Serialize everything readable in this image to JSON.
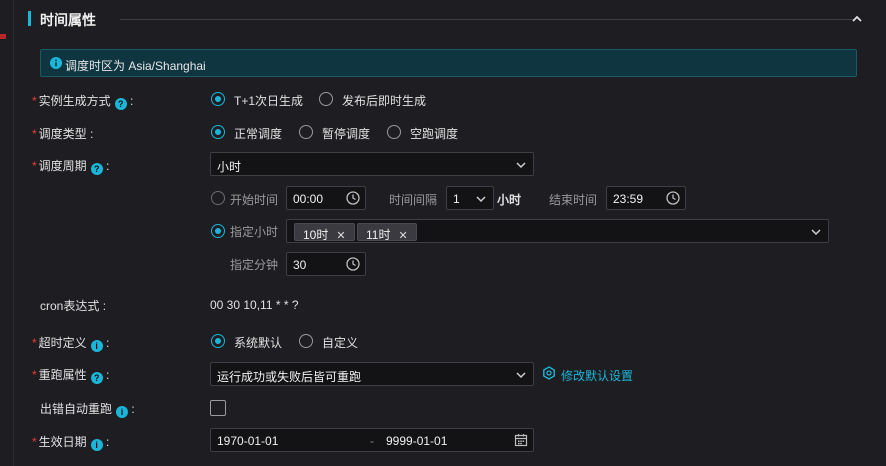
{
  "section": {
    "title": "时间属性"
  },
  "info": {
    "text": "调度时区为 Asia/Shanghai"
  },
  "instance_mode": {
    "label": "实例生成方式",
    "options": [
      "T+1次日生成",
      "发布后即时生成"
    ],
    "selected": 0
  },
  "schedule_type": {
    "label": "调度类型",
    "options": [
      "正常调度",
      "暂停调度",
      "空跑调度"
    ],
    "selected": 0
  },
  "schedule_cycle": {
    "label": "调度周期",
    "value": "小时",
    "mode_range": {
      "label": "开始时间",
      "start_time": "00:00",
      "interval_label": "时间间隔",
      "interval_value": "1",
      "interval_unit": "小时",
      "end_label": "结束时间",
      "end_time": "23:59"
    },
    "mode_specific": {
      "label": "指定小时",
      "tags": [
        "10时",
        "11时"
      ]
    },
    "minute": {
      "label": "指定分钟",
      "value": "30"
    },
    "selected_mode": "specific"
  },
  "cron": {
    "label": "cron表达式",
    "value": "00 30 10,11 * * ?"
  },
  "timeout": {
    "label": "超时定义",
    "options": [
      "系统默认",
      "自定义"
    ],
    "selected": 0
  },
  "rerun": {
    "label": "重跑属性",
    "value": "运行成功或失败后皆可重跑",
    "link": "修改默认设置"
  },
  "auto_rerun": {
    "label": "出错自动重跑",
    "checked": false
  },
  "effective_date": {
    "label": "生效日期",
    "start": "1970-01-01",
    "separator": "-",
    "end": "9999-01-01"
  },
  "colors": {
    "accent": "#1ab6d9",
    "required": "#e83a3a",
    "background": "#1e1e22"
  }
}
